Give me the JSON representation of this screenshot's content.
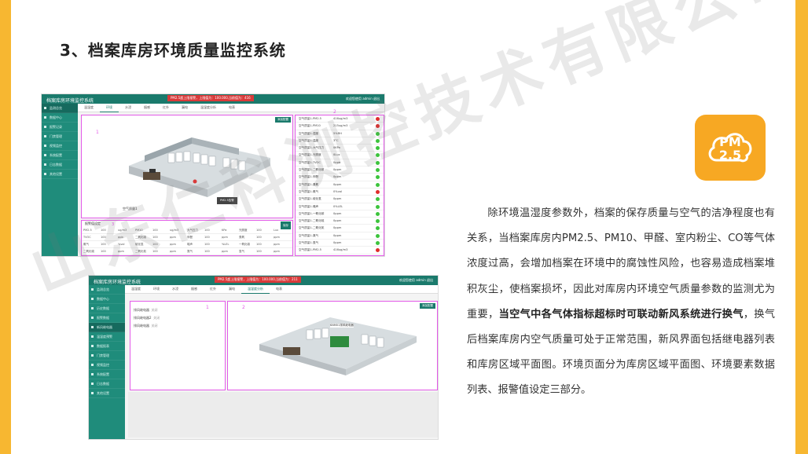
{
  "slide": {
    "title": "3、档案库房环境质量监控系统",
    "watermark": "山东仁科测控技术有限公司",
    "logo_text_1": "PM",
    "logo_text_2": "2.5",
    "paragraph_1": "除环境温湿度参数外，档案的保存质量与空气的洁净程度也有关系，当档案库房内PM2.5、PM10、甲醛、室内粉尘、CO等气体浓度过高，会增加档案在环境中的腐蚀性风险，也容易造成档案堆积灰尘，使档案损坏，因此对库房内环境空气质量参数的监测尤为重要，",
    "paragraph_bold": "当空气中各气体指标超标时可联动新风系统进行换气",
    "paragraph_2": "，换气后档案库房内空气质量可处于正常范围，新风界面包括继电器列表和库房区域平面图。环境页面分为库房区域平面图、环境要素数据列表、报警值设定三部分。"
  },
  "shot1": {
    "app_title": "档案库房环境监控系统",
    "alarm": "PM2.5超上限报警，上限值为：100.000,当前值为：416",
    "user": "欢迎您使用    admin    退出",
    "sidebar": [
      "监测总览",
      "数据中心",
      "报警记录",
      "门禁管理",
      "视频监控",
      "系统配置",
      "日志数据",
      "其他设置"
    ],
    "tabs": [
      "温湿度",
      "环境",
      "水浸",
      "烟感",
      "红外",
      "漏电",
      "温湿度分析",
      "电表"
    ],
    "map_button": "添加配置",
    "label_1": "1",
    "label_2": "2",
    "label_3": "3",
    "sensor_label": "空气质量1",
    "popup": "PM2.5告警",
    "readings": [
      {
        "name": "空气质量1-PM2.5",
        "value": "416ug/m3",
        "status": "red"
      },
      {
        "name": "空气质量1-PM10",
        "value": "215ug/m3",
        "status": "red"
      },
      {
        "name": "空气质量1-湿度",
        "value": "5%RH",
        "status": "green"
      },
      {
        "name": "空气质量1-温度",
        "value": "3°C",
        "status": "green"
      },
      {
        "name": "空气质量1-大气压力",
        "value": "0KPa",
        "status": "green"
      },
      {
        "name": "空气质量1-光照度",
        "value": "0Lux",
        "status": "green"
      },
      {
        "name": "空气质量1-TVOC",
        "value": "0ppb",
        "status": "green"
      },
      {
        "name": "空气质量1-二氧化碳",
        "value": "0ppm",
        "status": "green"
      },
      {
        "name": "空气质量1-甲醛",
        "value": "0ppm",
        "status": "green"
      },
      {
        "name": "空气质量1-臭氧",
        "value": "0ppm",
        "status": "green"
      },
      {
        "name": "空气质量1-氨气",
        "value": "0%vol",
        "status": "red"
      },
      {
        "name": "空气质量1-硫化氢",
        "value": "0ppm",
        "status": "green"
      },
      {
        "name": "空气质量1-噪声",
        "value": "0%LEL",
        "status": "green"
      },
      {
        "name": "空气质量1-一氧化碳",
        "value": "0ppm",
        "status": "green"
      },
      {
        "name": "空气质量1-二氧化硫",
        "value": "0ppm",
        "status": "green"
      },
      {
        "name": "空气质量1-二氧化氮",
        "value": "0ppm",
        "status": "green"
      },
      {
        "name": "空气质量1-氯气",
        "value": "0ppm",
        "status": "green"
      },
      {
        "name": "空气质量1-氢气",
        "value": "0ppm",
        "status": "green"
      },
      {
        "name": "空气质量1-PM2.5",
        "value": "416ug/m3",
        "status": "red"
      }
    ],
    "alarm_table_title": "报警值设定",
    "alarm_table_button": "保存",
    "alarm_rows": [
      [
        "PM2.5",
        "100",
        "ug/m3",
        "PM10",
        "100",
        "ug/m3",
        "大气压力",
        "100",
        "KPa",
        "光照度",
        "100",
        "Lux"
      ],
      [
        "TVOC",
        "100",
        "ppb",
        "二氧化碳",
        "100",
        "ppm",
        "甲醛",
        "100",
        "ppm",
        "臭氧",
        "100",
        "ppm"
      ],
      [
        "氨气",
        "100",
        "%vol",
        "硫化氢",
        "100",
        "ppm",
        "噪声",
        "100",
        "%LEL",
        "一氧化碳",
        "100",
        "ppm"
      ],
      [
        "二氧化硫",
        "100",
        "ppm",
        "二氧化氮",
        "100",
        "ppm",
        "氯气",
        "100",
        "ppm",
        "氢气",
        "100",
        "ppm"
      ]
    ]
  },
  "shot2": {
    "app_title": "档案库房环境监控系统",
    "alarm": "PM2.5超上限报警，上限值为：100.000,当前值为：211",
    "user": "欢迎您使用    admin    退出",
    "sidebar": [
      "监测总览",
      "数据中心",
      "历史数据",
      "报警数据",
      "新风继电器",
      "温湿度预警",
      "数据报表",
      "门禁管理",
      "视频监控",
      "系统配置",
      "日志数据",
      "其他设置"
    ],
    "tabs": [
      "温湿度",
      "环境",
      "水浸",
      "烟感",
      "红外",
      "漏电",
      "温湿度分析",
      "电表"
    ],
    "relays": [
      {
        "name": "排风继电器",
        "state": "关闭"
      },
      {
        "name": "排风继电器2",
        "state": "关闭"
      },
      {
        "name": "排风继电器",
        "state": "关闭"
      }
    ],
    "label_1": "1",
    "label_2": "2",
    "map_button": "添加配置",
    "node_label": "KNM01排风继电器"
  }
}
